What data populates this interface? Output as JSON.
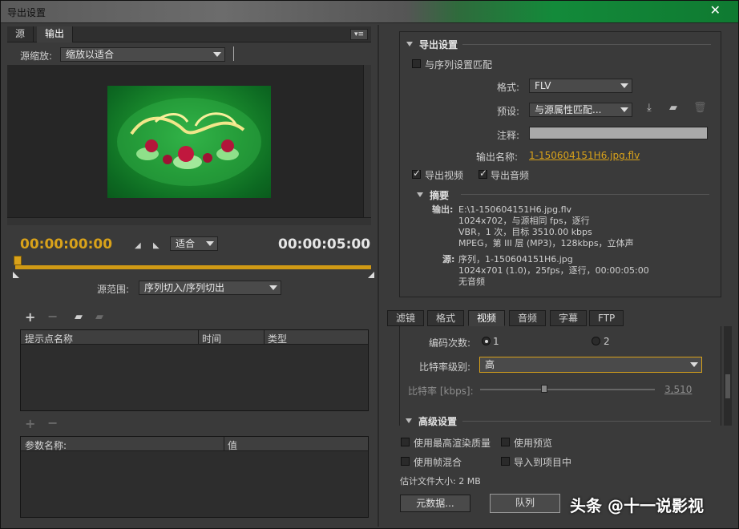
{
  "window": {
    "title": "导出设置",
    "close_glyph": "✕"
  },
  "left": {
    "tabs": [
      {
        "label": "源"
      },
      {
        "label": "输出"
      }
    ],
    "panel_menu_icon": "panel-menu-icon",
    "source_scale_label": "源缩放:",
    "source_scale_value": "缩放以适合",
    "current_time": "00:00:00:00",
    "duration": "00:00:05:00",
    "fit_value": "适合",
    "source_range_label": "源范围:",
    "source_range_value": "序列切入/序列切出",
    "cue_table": {
      "headers": [
        "提示点名称",
        "时间",
        "类型"
      ]
    },
    "param_table": {
      "headers": [
        "参数名称:",
        "值"
      ]
    }
  },
  "export": {
    "section_title": "导出设置",
    "match_sequence_label": "与序列设置匹配",
    "match_sequence_checked": false,
    "format_label": "格式:",
    "format_value": "FLV",
    "preset_label": "预设:",
    "preset_value": "与源属性匹配...",
    "comment_label": "注释:",
    "output_name_label": "输出名称:",
    "output_name_value": "1-150604151H6.jpg.flv",
    "export_video_label": "导出视频",
    "export_video_checked": true,
    "export_audio_label": "导出音频",
    "export_audio_checked": true,
    "summary": {
      "title": "摘要",
      "output_label": "输出:",
      "output_lines": [
        "E:\\1-150604151H6.jpg.flv",
        "1024x702，与源相同 fps，逐行",
        "VBR，1 次，目标 3510.00 kbps",
        "MPEG，第 III 层 (MP3)，128kbps，立体声"
      ],
      "source_label": "源:",
      "source_lines": [
        "序列，1-150604151H6.jpg",
        "1024x701 (1.0)，25fps，逐行，00:00:05:00",
        "无音频"
      ]
    }
  },
  "tabs": [
    {
      "label": "滤镜"
    },
    {
      "label": "格式"
    },
    {
      "label": "视频"
    },
    {
      "label": "音频"
    },
    {
      "label": "字幕"
    },
    {
      "label": "FTP"
    }
  ],
  "video": {
    "encoding_passes_label": "编码次数:",
    "pass_1": "1",
    "pass_2": "2",
    "selected_pass": 1,
    "bitrate_level_label": "比特率级别:",
    "bitrate_level_value": "高",
    "bitrate_label": "比特率 [kbps]:",
    "bitrate_value": "3,510",
    "advanced_title": "高级设置"
  },
  "bottom": {
    "max_render_quality": "使用最高渲染质量",
    "use_previews": "使用预览",
    "frame_blending": "使用帧混合",
    "import_into_project": "导入到项目中",
    "estimated_size": "估计文件大小: 2 MB",
    "metadata_button": "元数据...",
    "queue_button": "队列"
  },
  "watermark": "头条 @十一说影视"
}
